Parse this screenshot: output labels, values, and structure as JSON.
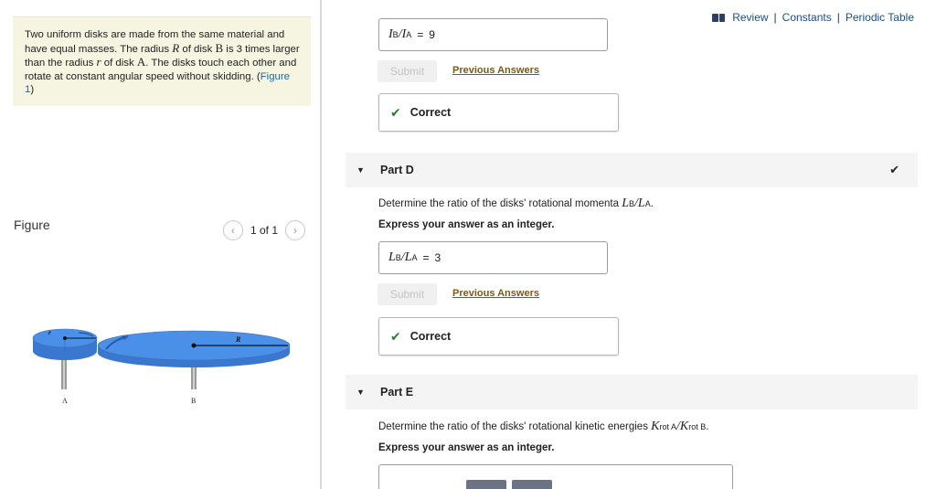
{
  "header": {
    "links": [
      "Review",
      "Constants",
      "Periodic Table"
    ]
  },
  "problem": {
    "t1": "Two uniform disks are made from the same material and have equal masses. The radius ",
    "var_R": "R",
    "t2": " of disk ",
    "disk_B": "B",
    "t3": " is 3 times larger than the radius ",
    "var_r": "r",
    "t4": " of disk ",
    "disk_A": "A",
    "t5": ". The disks touch each other and rotate at constant angular speed without skidding. (",
    "figure_link": "Figure 1",
    "t6": ")"
  },
  "figure": {
    "label": "Figure",
    "page": "1 of 1",
    "label_r": "r",
    "label_R": "R",
    "label_A": "A",
    "label_B": "B"
  },
  "part_c": {
    "answer_lhs": "I",
    "answer_lhs_sub": "B",
    "answer_rhs": "I",
    "answer_rhs_sub": "A",
    "equals": "=",
    "answer_value": "9",
    "submit": "Submit",
    "previous_answers": "Previous Answers",
    "correct": "Correct"
  },
  "part_d": {
    "title": "Part D",
    "question_prefix": "Determine the ratio of the disks' rotational momenta ",
    "q_lhs": "L",
    "q_lhs_sub": "B",
    "q_rhs": "L",
    "q_rhs_sub": "A",
    "question_suffix": ".",
    "instruction": "Express your answer as an integer.",
    "answer_value": "3",
    "equals": "=",
    "submit": "Submit",
    "previous_answers": "Previous Answers",
    "correct": "Correct"
  },
  "part_e": {
    "title": "Part E",
    "question_prefix": "Determine the ratio of the disks' rotational kinetic energies ",
    "q_lhs": "K",
    "q_lhs_sub": "rot A",
    "q_rhs": "K",
    "q_rhs_sub": "rot B",
    "question_suffix": ".",
    "instruction": "Express your answer as an integer."
  },
  "colors": {
    "disk": "#4a8fe8",
    "problem_bg": "#f5f5e2",
    "link": "#1a4f8a",
    "check": "#2e7d32"
  }
}
